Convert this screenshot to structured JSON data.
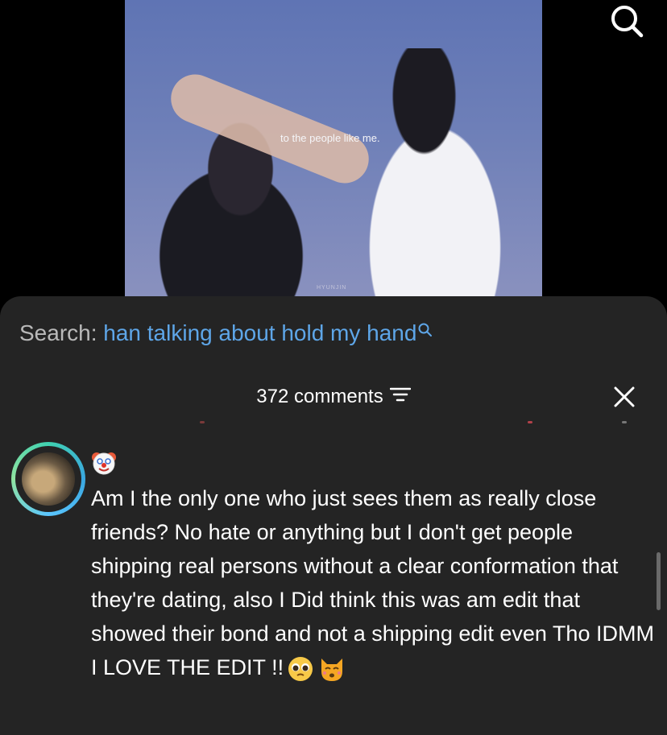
{
  "video": {
    "caption": "to the people like me.",
    "watermark": "HYUNJIN"
  },
  "header_icons": [
    "search-icon"
  ],
  "search": {
    "label": "Search:",
    "query": "han talking about hold my hand"
  },
  "comments": {
    "count_label": "372 comments",
    "icons": [
      "filter-icon",
      "close-icon"
    ]
  },
  "comment": {
    "badge_icon": "clown-face-emoji",
    "text": "Am I the only one who just sees them as really close friends? No hate or anything but I don't get people shipping real persons without a clear conformation that they're dating, also I Did think this was am edit that showed their bond and not a shipping edit even Tho IDMM I LOVE THE EDIT !!",
    "trailing_emojis": [
      "pleading-face-emoji",
      "kissing-cat-emoji"
    ]
  },
  "colors": {
    "sheet_bg": "#242424",
    "query_link": "#5ea6e8",
    "avatar_ring": "#3fd1b0"
  }
}
